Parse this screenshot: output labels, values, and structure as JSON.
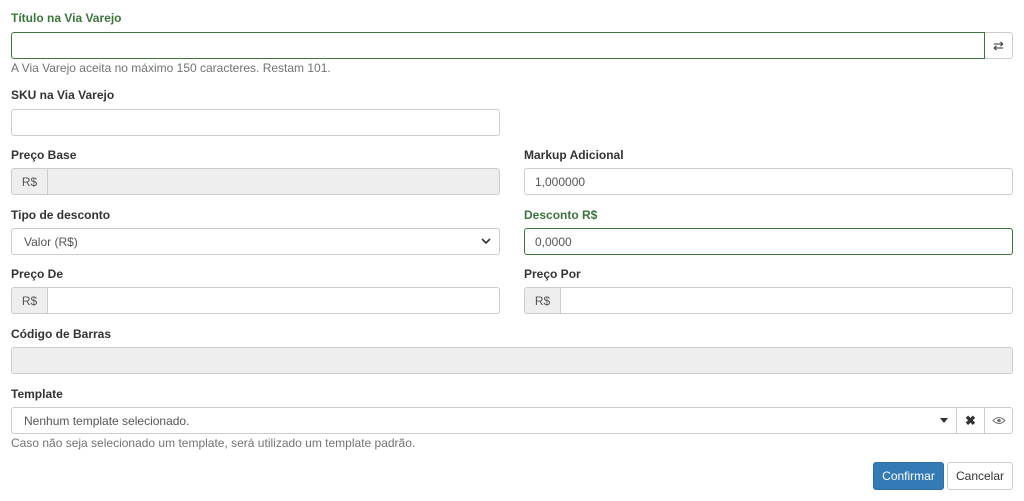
{
  "titulo": {
    "label": "Título na Via Varejo",
    "value": "",
    "help": "A Via Varejo aceita no máximo 150 caracteres. Restam 101.",
    "swap_icon": "swap-arrows-icon"
  },
  "sku": {
    "label": "SKU na Via Varejo",
    "value": ""
  },
  "preco_base": {
    "label": "Preço Base",
    "currency": "R$",
    "value": ""
  },
  "markup": {
    "label": "Markup Adicional",
    "value": "1,000000"
  },
  "tipo_desconto": {
    "label": "Tipo de desconto",
    "selected": "Valor (R$)"
  },
  "desconto": {
    "label": "Desconto R$",
    "value": "0,0000"
  },
  "preco_de": {
    "label": "Preço De",
    "currency": "R$",
    "value": ""
  },
  "preco_por": {
    "label": "Preço Por",
    "currency": "R$",
    "value": ""
  },
  "codigo_barras": {
    "label": "Código de Barras",
    "value": ""
  },
  "template": {
    "label": "Template",
    "placeholder": "Nenhum template selecionado.",
    "help": "Caso não seja selecionado um template, será utilizado um template padrão."
  },
  "actions": {
    "confirm_label": "Confirmar",
    "cancel_label": "Cancelar"
  },
  "colors": {
    "success": "#3c763d",
    "primary": "#337ab7",
    "border": "#cccccc",
    "disabled": "#eeeeee"
  }
}
